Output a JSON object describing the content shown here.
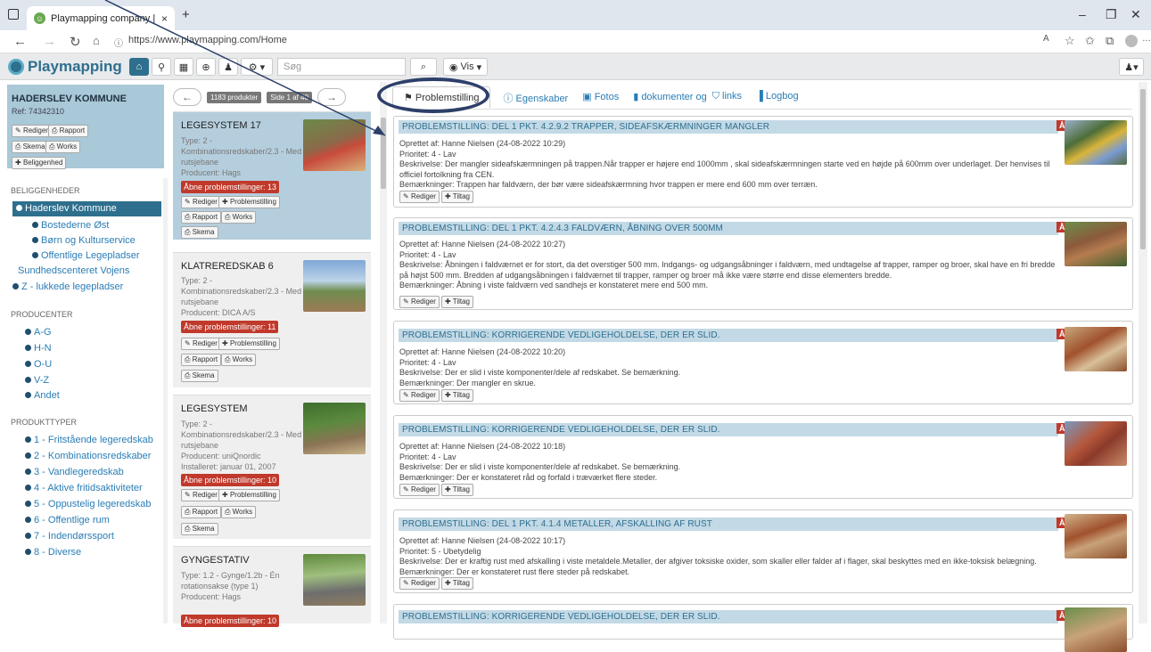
{
  "browser": {
    "tab_title": "Playmapping company | Playgro",
    "url": "https://www.playmapping.com/Home",
    "new_tab": "+",
    "tab_close": "×"
  },
  "app": {
    "logo": "Playmapping",
    "search_placeholder": "Søg",
    "view_label": "Vis",
    "user_icon": "user-icon"
  },
  "info": {
    "title": "HADERSLEV KOMMUNE",
    "ref": "Ref: 74342310",
    "buttons": [
      "Rediger",
      "Rapport",
      "Skema",
      "Works",
      "Beliggenhed"
    ]
  },
  "sidebar": {
    "sec_locations": "BELIGGENHEDER",
    "locations": [
      {
        "label": "Haderslev Kommune",
        "selected": true
      },
      {
        "label": "Bostederne Øst"
      },
      {
        "label": "Børn og Kulturservice"
      },
      {
        "label": "Offentlige Legepladser"
      },
      {
        "label": "Sundhedscenteret Vojens"
      },
      {
        "label": "Z - lukkede legepladser"
      }
    ],
    "sec_producers": "PRODUCENTER",
    "producers": [
      "A-G",
      "H-N",
      "O-U",
      "V-Z",
      "Andet"
    ],
    "sec_types": "PRODUKTTYPER",
    "types": [
      "1 - Fritstående legeredskab",
      "2 - Kombinationsredskaber",
      "3 - Vandlegeredskab",
      "4 - Aktive fritidsaktiviteter",
      "5 - Oppustelig legeredskab",
      "6 - Offentlige rum",
      "7 - Indendørssport",
      "8 - Diverse"
    ]
  },
  "products": {
    "count": "1183 produkter",
    "page": "Side 1 af 40",
    "prev": "←",
    "next": "→",
    "btn_edit": "Rediger",
    "btn_problem": "Problemstilling",
    "btn_report": "Rapport",
    "btn_works": "Works",
    "btn_schema": "Skema",
    "items": [
      {
        "name": "LEGESYSTEM 17",
        "type": "Type: 2 - Kombinationsredskaber/2.3 - Med rutsjebane",
        "producer": "Producent: Hags",
        "installed": "",
        "open": "Åbne problemstillinger: 13"
      },
      {
        "name": "KLATREREDSKAB 6",
        "type": "Type: 2 - Kombinationsredskaber/2.3 - Med rutsjebane",
        "producer": "Producent: DICA A/S",
        "installed": "",
        "open": "Åbne problemstillinger: 11"
      },
      {
        "name": "LEGESYSTEM",
        "type": "Type: 2 - Kombinationsredskaber/2.3 - Med rutsjebane",
        "producer": "Producent: uniQnordic",
        "installed": "Installeret: januar 01, 2007",
        "open": "Åbne problemstillinger: 10"
      },
      {
        "name": "GYNGESTATIV",
        "type": "Type: 1.2 - Gynge/1.2b - Én rotationsakse (type 1)",
        "producer": "Producent: Hags",
        "installed": "",
        "open": "Åbne problemstillinger: 10"
      }
    ]
  },
  "tabs": [
    {
      "label": "Problemstilling",
      "icon": "flag-icon",
      "active": true
    },
    {
      "label": "Egenskaber",
      "icon": "info-icon"
    },
    {
      "label": "Fotos",
      "icon": "image-icon"
    },
    {
      "label": "dokumenter og",
      "icon": "file-icon"
    },
    {
      "label": "links",
      "icon": "bookmark-icon"
    },
    {
      "label": "Logbog",
      "icon": "book-icon"
    }
  ],
  "problems": {
    "open_label": "ÅBEN",
    "edit": "Rediger",
    "action": "Tiltag",
    "items": [
      {
        "title": "PROBLEMSTILLING: DEL 1 PKT. 4.2.9.2 TRAPPER, SIDEAFSKÆRMNINGER MANGLER",
        "created": "Oprettet af: Hanne Nielsen (24-08-2022 10:29)",
        "priority": "Prioritet: 4 - Lav",
        "desc": "Beskrivelse: Der mangler sideafskærmningen på trappen.Når trapper er højere end 1000mm , skal sideafskærmningen starte ved en højde på 600mm over underlaget. Der henvises til officiel fortolkning fra CEN.",
        "note": "Bemærkninger: Trappen har faldværn, der bør være sideafskærmning hvor trappen er mere end 600 mm over terræn."
      },
      {
        "title": "PROBLEMSTILLING: DEL 1 PKT. 4.2.4.3 FALDVÆRN, ÅBNING OVER 500MM",
        "created": "Oprettet af: Hanne Nielsen (24-08-2022 10:27)",
        "priority": "Prioritet: 4 - Lav",
        "desc": "Beskrivelse: Åbningen i faldværnet er for stort, da det overstiger 500 mm. Indgangs- og udgangsåbninger i faldværn, med undtagelse af trapper, ramper og broer, skal have en fri bredde på højst 500 mm. Bredden af udgangsåbningen i faldværnet til trapper, ramper og broer må ikke være større end disse elementers bredde.",
        "note": "Bemærkninger: Åbning i viste faldværn ved sandhejs er konstateret mere end 500 mm."
      },
      {
        "title": "PROBLEMSTILLING: KORRIGERENDE VEDLIGEHOLDELSE, DER ER SLID.",
        "created": "Oprettet af: Hanne Nielsen (24-08-2022 10:20)",
        "priority": "Prioritet: 4 - Lav",
        "desc": "Beskrivelse: Der er slid i viste komponenter/dele af redskabet. Se bemærkning.",
        "note": "Bemærkninger: Der mangler en skrue."
      },
      {
        "title": "PROBLEMSTILLING: KORRIGERENDE VEDLIGEHOLDELSE, DER ER SLID.",
        "created": "Oprettet af: Hanne Nielsen (24-08-2022 10:18)",
        "priority": "Prioritet: 4 - Lav",
        "desc": "Beskrivelse: Der er slid i viste komponenter/dele af redskabet. Se bemærkning.",
        "note": "Bemærkninger: Der er konstateret råd og forfald i træværket flere steder."
      },
      {
        "title": "PROBLEMSTILLING: DEL 1 PKT. 4.1.4 METALLER, AFSKALLING AF RUST",
        "created": "Oprettet af: Hanne Nielsen (24-08-2022 10:17)",
        "priority": "Prioritet: 5 - Ubetydelig",
        "desc": "Beskrivelse: Der er kraftig rust med afskalling i viste metaldele.Metaller, der afgiver toksiske oxider, som skaller eller falder af i flager, skal beskyttes med en ikke-toksisk belægning.",
        "note": "Bemærkninger: Der er konstateret rust flere steder på redskabet."
      },
      {
        "title": "PROBLEMSTILLING: KORRIGERENDE VEDLIGEHOLDELSE, DER ER SLID.",
        "created": "",
        "priority": "",
        "desc": "",
        "note": ""
      }
    ]
  },
  "colors": {
    "accent": "#2e6f8e",
    "danger": "#c0392b",
    "header_bg": "#c3d9e6",
    "link": "#2a7db5"
  }
}
